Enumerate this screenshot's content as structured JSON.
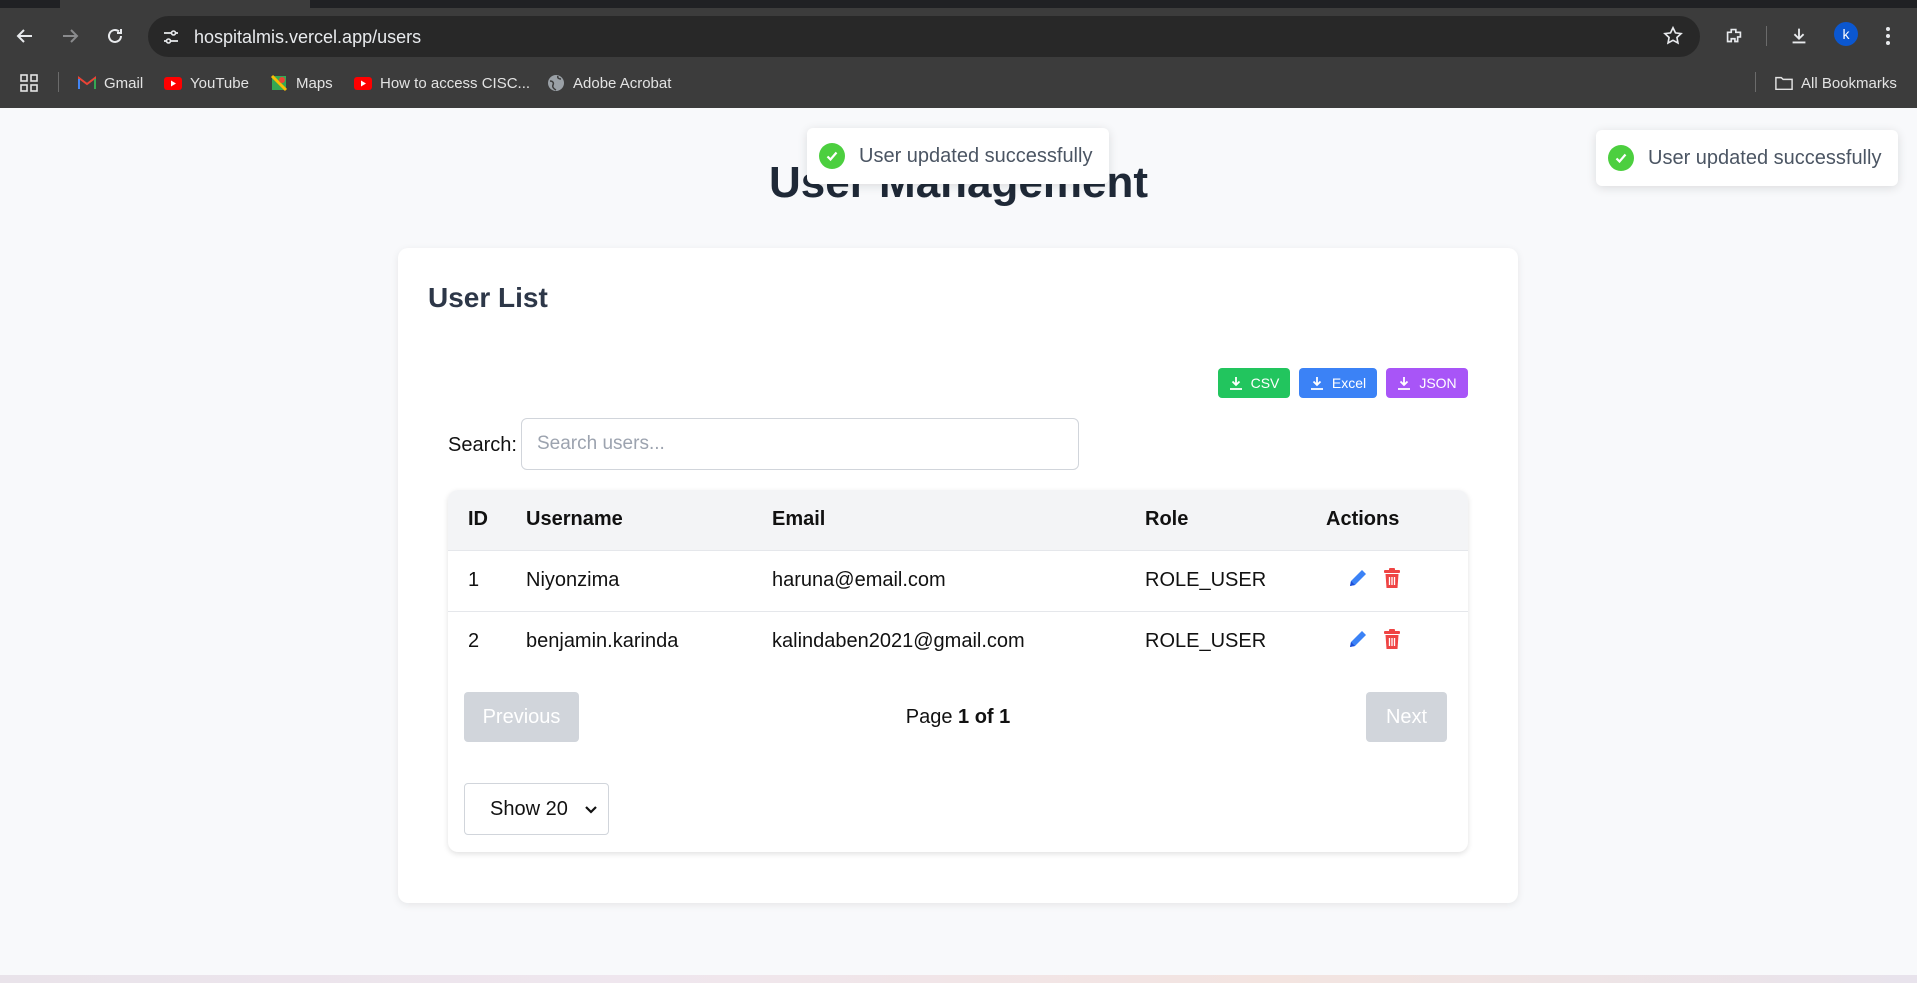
{
  "browser": {
    "url": "hospitalmis.vercel.app/users",
    "profile_initial": "k",
    "bookmarks": [
      "Gmail",
      "YouTube",
      "Maps",
      "How to access CISC...",
      "Adobe Acrobat"
    ],
    "all_bookmarks": "All Bookmarks"
  },
  "page": {
    "title": "User Management"
  },
  "card": {
    "title": "User List",
    "exports": {
      "csv": "CSV",
      "excel": "Excel",
      "json": "JSON"
    },
    "search": {
      "label": "Search:",
      "placeholder": "Search users..."
    }
  },
  "table": {
    "headers": {
      "id": "ID",
      "username": "Username",
      "email": "Email",
      "role": "Role",
      "actions": "Actions"
    },
    "rows": [
      {
        "id": "1",
        "username": "Niyonzima",
        "email": "haruna@email.com",
        "role": "ROLE_USER"
      },
      {
        "id": "2",
        "username": "benjamin.karinda",
        "email": "kalindaben2021@gmail.com",
        "role": "ROLE_USER"
      }
    ]
  },
  "pagination": {
    "previous": "Previous",
    "next": "Next",
    "page_prefix": "Page",
    "page_status": "1 of 1",
    "show_option": "Show 20"
  },
  "toasts": [
    "User updated successfully",
    "User updated successfully"
  ],
  "colors": {
    "csv": "#22c55e",
    "excel": "#3b82f6",
    "json": "#a855f7",
    "edit_icon": "#3b82f6",
    "delete_icon": "#ef4444",
    "success": "#4ccf3f"
  }
}
